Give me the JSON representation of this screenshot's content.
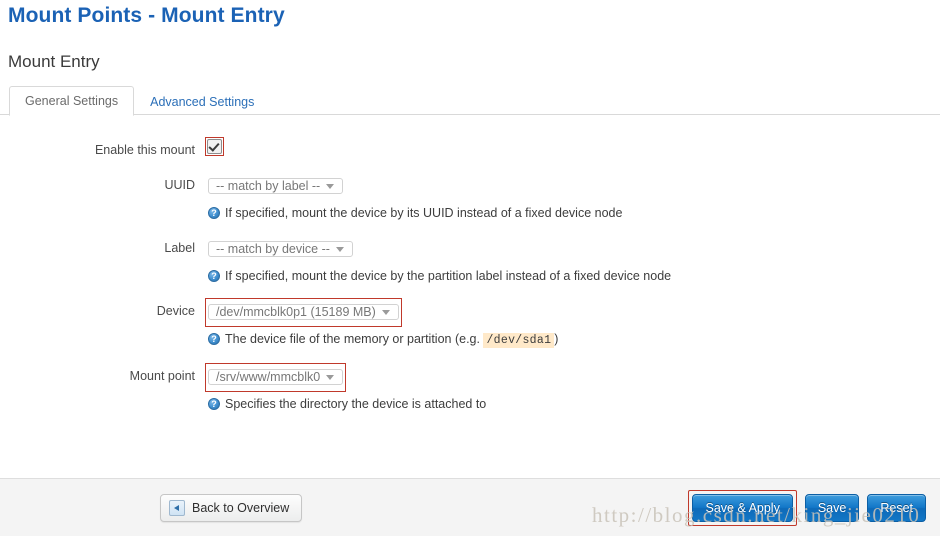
{
  "page": {
    "title": "Mount Points - Mount Entry",
    "section_title": "Mount Entry",
    "title_color": "#1b62b5",
    "watermark": "http://blog.csdn.net/king_jie0210"
  },
  "tabs": [
    {
      "label": "General Settings",
      "active": true
    },
    {
      "label": "Advanced Settings",
      "active": false
    }
  ],
  "form": {
    "enable": {
      "label": "Enable this mount",
      "checked": true,
      "invalid": true
    },
    "uuid": {
      "label": "UUID",
      "value": "-- match by label --",
      "help": "If specified, mount the device by its UUID instead of a fixed device node",
      "invalid": false
    },
    "label_field": {
      "label": "Label",
      "value": "-- match by device --",
      "help": "If specified, mount the device by the partition label instead of a fixed device node",
      "invalid": false
    },
    "device": {
      "label": "Device",
      "value": "/dev/mmcblk0p1 (15189 MB)",
      "help_prefix": "The device file of the memory or partition (",
      "help_eg": "e.g.",
      "help_code": "/dev/sda1",
      "help_suffix": ")",
      "invalid": true
    },
    "mount_point": {
      "label": "Mount point",
      "value": "/srv/www/mmcblk0",
      "help": "Specifies the directory the device is attached to",
      "invalid": true
    }
  },
  "footer": {
    "back_label": "Back to Overview",
    "save_apply_label": "Save & Apply",
    "save_label": "Save",
    "reset_label": "Reset",
    "accent_color": "#1277c8",
    "invalid_color": "#c0392b"
  },
  "icons": {
    "help": "?",
    "back": "back-arrow-icon",
    "dropdown": "chevron-down-icon",
    "check": "check-icon"
  }
}
